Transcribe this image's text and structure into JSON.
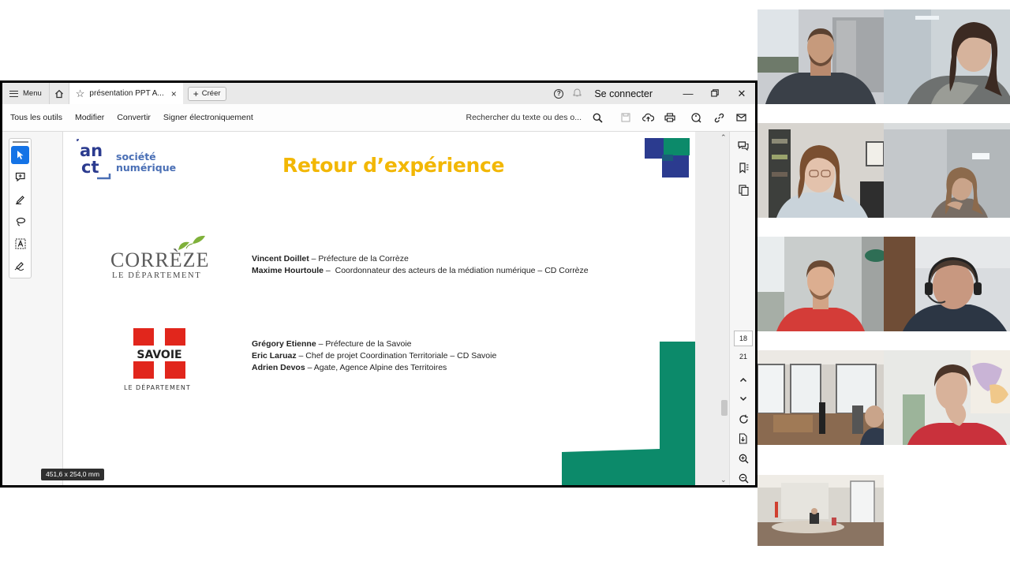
{
  "titlebar": {
    "menu_label": "Menu",
    "tab_title": "présentation PPT A...",
    "create_label": "Créer",
    "connect_label": "Se connecter",
    "icons": [
      "hamburger-icon",
      "home-icon",
      "star-icon",
      "close-icon",
      "plus-icon",
      "help-icon",
      "bell-icon",
      "minimize-icon",
      "restore-icon",
      "close-icon"
    ]
  },
  "toolbar": {
    "items": [
      "Tous les outils",
      "Modifier",
      "Convertir",
      "Signer électroniquement"
    ],
    "search_label": "Rechercher du texte ou des o...",
    "icons": [
      "search-icon",
      "save-icon",
      "upload-icon",
      "print-icon",
      "accessibility-icon",
      "link-icon",
      "mail-icon"
    ]
  },
  "left_tools": [
    "cursor-icon",
    "comment-icon",
    "pen-icon",
    "lasso-icon",
    "text-select-icon",
    "signature-icon"
  ],
  "right_rail": {
    "current_page": "18",
    "total_pages": "21",
    "icons": [
      "comments-icon",
      "bookmark-icon",
      "pages-icon",
      "chevron-up-icon",
      "chevron-down-icon",
      "rotate-icon",
      "export-icon",
      "zoom-in-icon",
      "zoom-out-icon"
    ]
  },
  "page_size_tooltip": "451,6 x 254,0 mm",
  "slide": {
    "title": "Retour d’expérience",
    "logo_anct": {
      "line1": "an",
      "line2": "ct",
      "sub1": "société",
      "sub2": "numérique"
    },
    "correze_logo": {
      "word": "CORRÈZE",
      "sub": "LE DÉPARTEMENT"
    },
    "savoie_logo": {
      "word": "SAVOIE",
      "sub": "LE DÉPARTEMENT"
    },
    "group1": [
      {
        "name": "Vincent Doillet",
        "role": " – Préfecture de la Corrèze"
      },
      {
        "name": "Maxime Hourtoule",
        "role": " –  Coordonnateur des acteurs de la médiation numérique – CD Corrèze"
      }
    ],
    "group2": [
      {
        "name": "Grégory Etienne",
        "role": " – Préfecture de la Savoie"
      },
      {
        "name": "Eric Laruaz",
        "role": " – Chef de projet Coordination Territoriale – CD Savoie"
      },
      {
        "name": "Adrien Devos",
        "role": " – Agate, Agence Alpine des Territoires"
      }
    ],
    "colors": {
      "title": "#f2b705",
      "anct_blue": "#4a6fb5",
      "navy": "#2b3b8f",
      "green": "#0c8a6a",
      "savoie_red": "#e1261c"
    }
  },
  "participants": [
    "participant-1",
    "participant-2",
    "participant-3",
    "participant-4",
    "participant-5",
    "participant-6",
    "participant-7",
    "participant-8",
    "participant-9"
  ]
}
